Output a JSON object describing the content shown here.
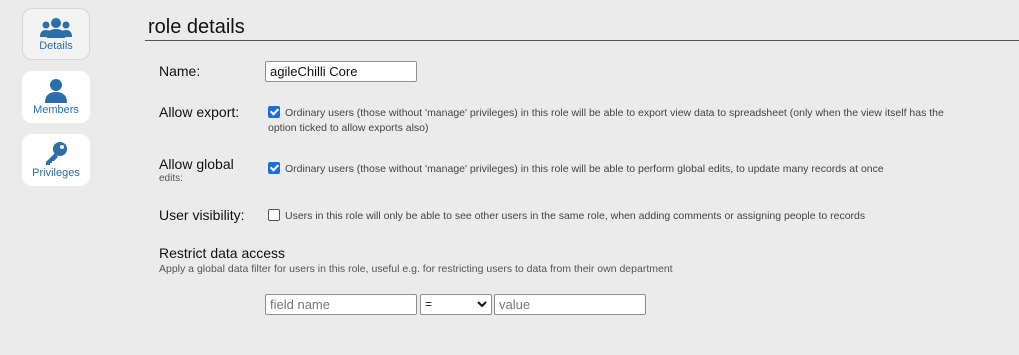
{
  "tabs": [
    {
      "label": "Details",
      "icon": "users-group-icon",
      "active": true
    },
    {
      "label": "Members",
      "icon": "person-icon",
      "active": false
    },
    {
      "label": "Privileges",
      "icon": "key-icon",
      "active": false
    }
  ],
  "page_title": "role details",
  "name_field": {
    "label": "Name:",
    "value": "agileChilli Core"
  },
  "allow_export": {
    "label": "Allow export:",
    "checked": true,
    "line1": "Ordinary users (those without 'manage' privileges) in this role will be able to export view data to spreadsheet (only when the view itself has the",
    "line2": "option ticked to allow exports also)"
  },
  "allow_global": {
    "label": "Allow global",
    "sublabel": "edits:",
    "checked": true,
    "text": "Ordinary users (those without 'manage' privileges) in this role will be able to perform global edits, to update many records at once"
  },
  "user_visibility": {
    "label": "User visibility:",
    "checked": false,
    "text": "Users in this role will only be able to see other users in the same role, when adding comments or assigning people to records"
  },
  "restrict": {
    "title": "Restrict data access",
    "description": "Apply a global data filter for users in this role, useful e.g. for restricting users to data from their own department",
    "field_placeholder": "field name",
    "operator": "=",
    "value_placeholder": "value"
  },
  "colors": {
    "accent": "#2b6eaa",
    "checkbox": "#1a6fd9",
    "background": "#ebebeb"
  }
}
